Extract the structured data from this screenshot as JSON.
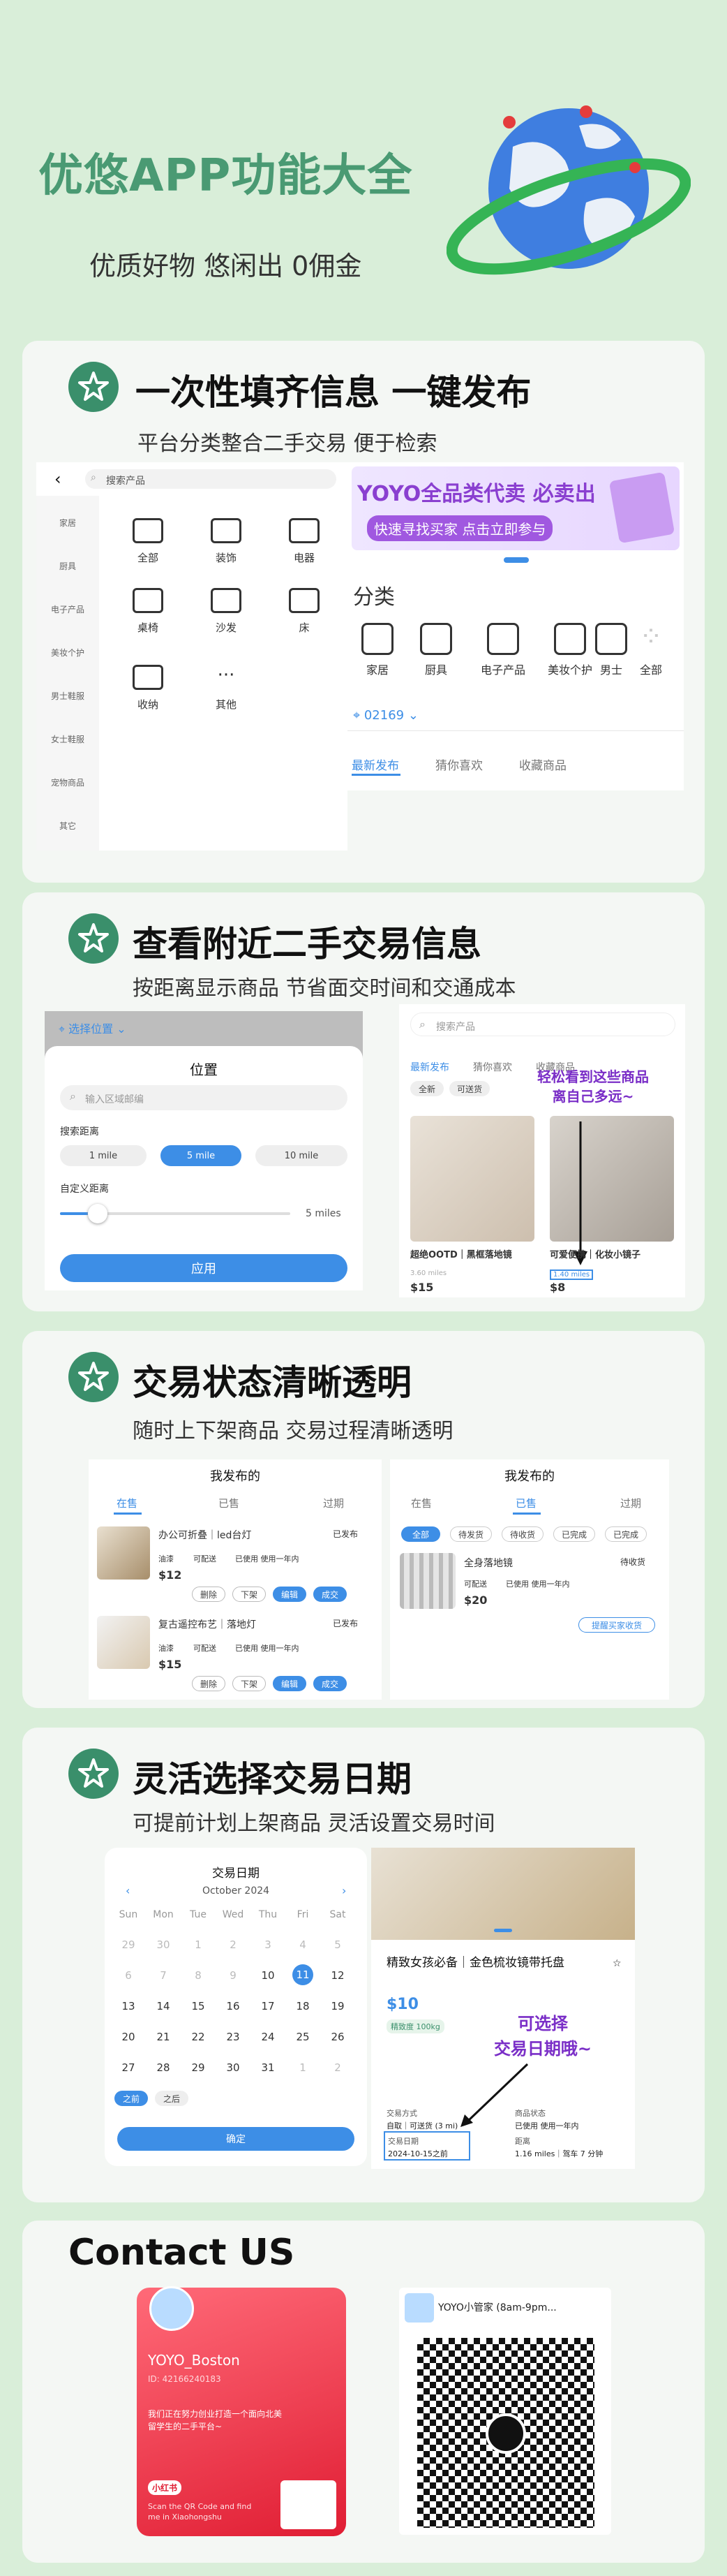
{
  "hero": {
    "title": "优悠APP功能大全",
    "subtitle": "优质好物 悠闲出 0佣金"
  },
  "sections": [
    {
      "title": "一次性填齐信息 一键发布",
      "subtitle": "平台分类整合二手交易 便于检索"
    },
    {
      "title": "查看附近二手交易信息",
      "subtitle": "按距离显示商品 节省面交时间和交通成本"
    },
    {
      "title": "交易状态清晰透明",
      "subtitle": "随时上下架商品 交易过程清晰透明"
    },
    {
      "title": "灵活选择交易日期",
      "subtitle": "可提前计划上架商品 灵活设置交易时间"
    }
  ],
  "s1": {
    "search_placeholder": "搜索产品",
    "sidebar": [
      "家居",
      "厨具",
      "电子产品",
      "美妆个护",
      "男士鞋服",
      "女士鞋服",
      "宠物商品",
      "其它"
    ],
    "grid": [
      "全部",
      "装饰",
      "电器",
      "桌椅",
      "沙发",
      "床",
      "收纳",
      "其他"
    ],
    "banner_line1": "YOYO全品类代卖 必卖出",
    "banner_line2": "快速寻找买家 点击立即参与",
    "category_heading": "分类",
    "categories": [
      "家居",
      "厨具",
      "电子产品",
      "美妆个护",
      "男士",
      "全部"
    ],
    "zip": "02169",
    "tabs": [
      "最新发布",
      "猜你喜欢",
      "收藏商品"
    ]
  },
  "s2": {
    "location_label": "选择位置",
    "modal_title": "位置",
    "zip_placeholder": "输入区域邮编",
    "distance_label": "搜索距离",
    "distances": [
      "1 mile",
      "5 mile",
      "10 mile"
    ],
    "custom_label": "自定义距离",
    "slider_value": "5 miles",
    "apply": "应用",
    "search_placeholder": "搜索产品",
    "tabs": [
      "最新发布",
      "猜你喜欢",
      "收藏商品"
    ],
    "filters": [
      "全新",
      "可送货"
    ],
    "callout": "轻松看到这些商品\n离自己多远~",
    "item1_name": "超绝OOTD｜黑框落地镜",
    "item1_dist": "3.60 miles",
    "item1_price": "$15",
    "item2_name": "可爱便携｜化妆小镜子",
    "item2_dist": "1.40 miles",
    "item2_price": "$8"
  },
  "s3": {
    "left_title": "我发布的",
    "left_tabs": [
      "在售",
      "已售",
      "过期"
    ],
    "items": [
      {
        "name": "办公可折叠｜led台灯",
        "status": "已发布",
        "price": "$12"
      },
      {
        "name": "复古遥控布艺｜落地灯",
        "status": "已发布",
        "price": "$15"
      }
    ],
    "tags": [
      "油漆",
      "可配送",
      "已使用 使用一年内"
    ],
    "actions": [
      "删除",
      "下架",
      "编辑",
      "成交"
    ],
    "right_title": "我发布的",
    "right_tabs": [
      "在售",
      "已售",
      "过期"
    ],
    "right_chips": [
      "全部",
      "待发货",
      "待收货",
      "已完成",
      "已完成"
    ],
    "right_item_name": "全身落地镜",
    "right_item_status": "待收货",
    "right_item_price": "$20",
    "right_action": "提醒买家收货"
  },
  "s4": {
    "cal_title": "交易日期",
    "month": "October 2024",
    "weekdays": [
      "Sun",
      "Mon",
      "Tue",
      "Wed",
      "Thu",
      "Fri",
      "Sat"
    ],
    "weeks": [
      [
        "29",
        "30",
        "1",
        "2",
        "3",
        "4",
        "5"
      ],
      [
        "6",
        "7",
        "8",
        "9",
        "10",
        "11",
        "12"
      ],
      [
        "13",
        "14",
        "15",
        "16",
        "17",
        "18",
        "19"
      ],
      [
        "20",
        "21",
        "22",
        "23",
        "24",
        "25",
        "26"
      ],
      [
        "27",
        "28",
        "29",
        "30",
        "31",
        "1",
        "2"
      ]
    ],
    "selected_day": "11",
    "before": "之前",
    "after": "之后",
    "confirm": "确定",
    "product_title": "精致女孩必备｜金色梳妆镜带托盘",
    "price": "$10",
    "tag": "精致度 100kg",
    "callout": "可选择\n交易日期哦~",
    "meta_left_1": "交易方式",
    "meta_left_2": "自取｜可送货 (3 mi)",
    "meta_left_3": "交易日期",
    "meta_left_4": "2024-10-15之前",
    "meta_right_1": "商品状态",
    "meta_right_2": "已使用 使用一年内",
    "meta_right_3": "距离",
    "meta_right_4": "1.16 miles｜驾车 7 分钟"
  },
  "contact": {
    "title": "Contact US",
    "xhs_name": "YOYO_Boston",
    "xhs_id": "ID: 42166240183",
    "xhs_desc": "我们正在努力创业打造一个面向北美留学生的二手平台~",
    "xhs_badge": "小红书",
    "xhs_scan": "Scan the QR Code and find me in Xiaohongshu",
    "wechat_name": "YOYO小管家 (8am-9pm..."
  }
}
